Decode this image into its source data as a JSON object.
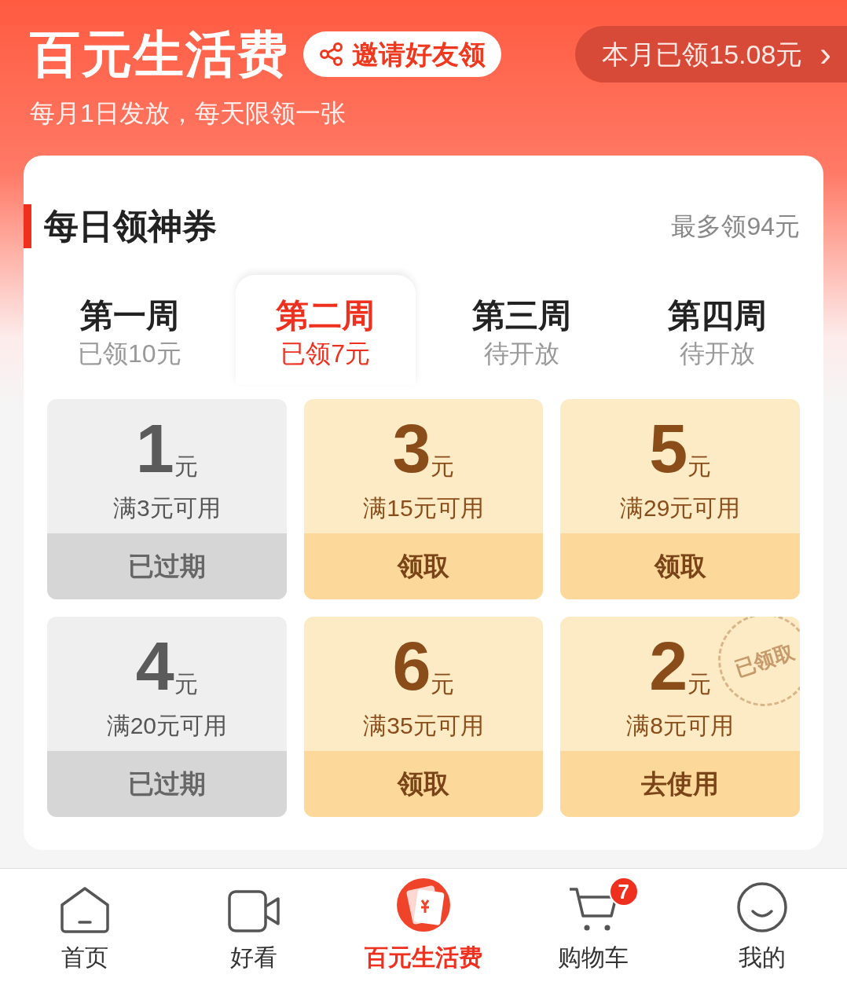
{
  "header": {
    "title": "百元生活费",
    "invite_button": "邀请好友领",
    "monthly_button": "本月已领15.08元",
    "monthly_arrow": "›",
    "subtitle": "每月1日发放，每天限领一张"
  },
  "section": {
    "title": "每日领神券",
    "note": "最多领94元"
  },
  "weeks": [
    {
      "label": "第一周",
      "status": "已领10元",
      "selected": false
    },
    {
      "label": "第二周",
      "status": "已领7元",
      "selected": true
    },
    {
      "label": "第三周",
      "status": "待开放",
      "selected": false
    },
    {
      "label": "第四周",
      "status": "待开放",
      "selected": false
    }
  ],
  "coupons": [
    {
      "amount": "1",
      "unit": "元",
      "condition": "满3元可用",
      "action": "已过期",
      "kind": "expired"
    },
    {
      "amount": "3",
      "unit": "元",
      "condition": "满15元可用",
      "action": "领取",
      "kind": "available"
    },
    {
      "amount": "5",
      "unit": "元",
      "condition": "满29元可用",
      "action": "领取",
      "kind": "available"
    },
    {
      "amount": "4",
      "unit": "元",
      "condition": "满20元可用",
      "action": "已过期",
      "kind": "expired"
    },
    {
      "amount": "6",
      "unit": "元",
      "condition": "满35元可用",
      "action": "领取",
      "kind": "available"
    },
    {
      "amount": "2",
      "unit": "元",
      "condition": "满8元可用",
      "action": "去使用",
      "kind": "available",
      "stamp": "已领取"
    }
  ],
  "nav": [
    {
      "label": "首页",
      "kind": "home",
      "selected": false
    },
    {
      "label": "好看",
      "kind": "video",
      "selected": false
    },
    {
      "label": "百元生活费",
      "kind": "special",
      "selected": true
    },
    {
      "label": "购物车",
      "kind": "cart",
      "selected": false,
      "badge": "7"
    },
    {
      "label": "我的",
      "kind": "profile",
      "selected": false
    }
  ]
}
